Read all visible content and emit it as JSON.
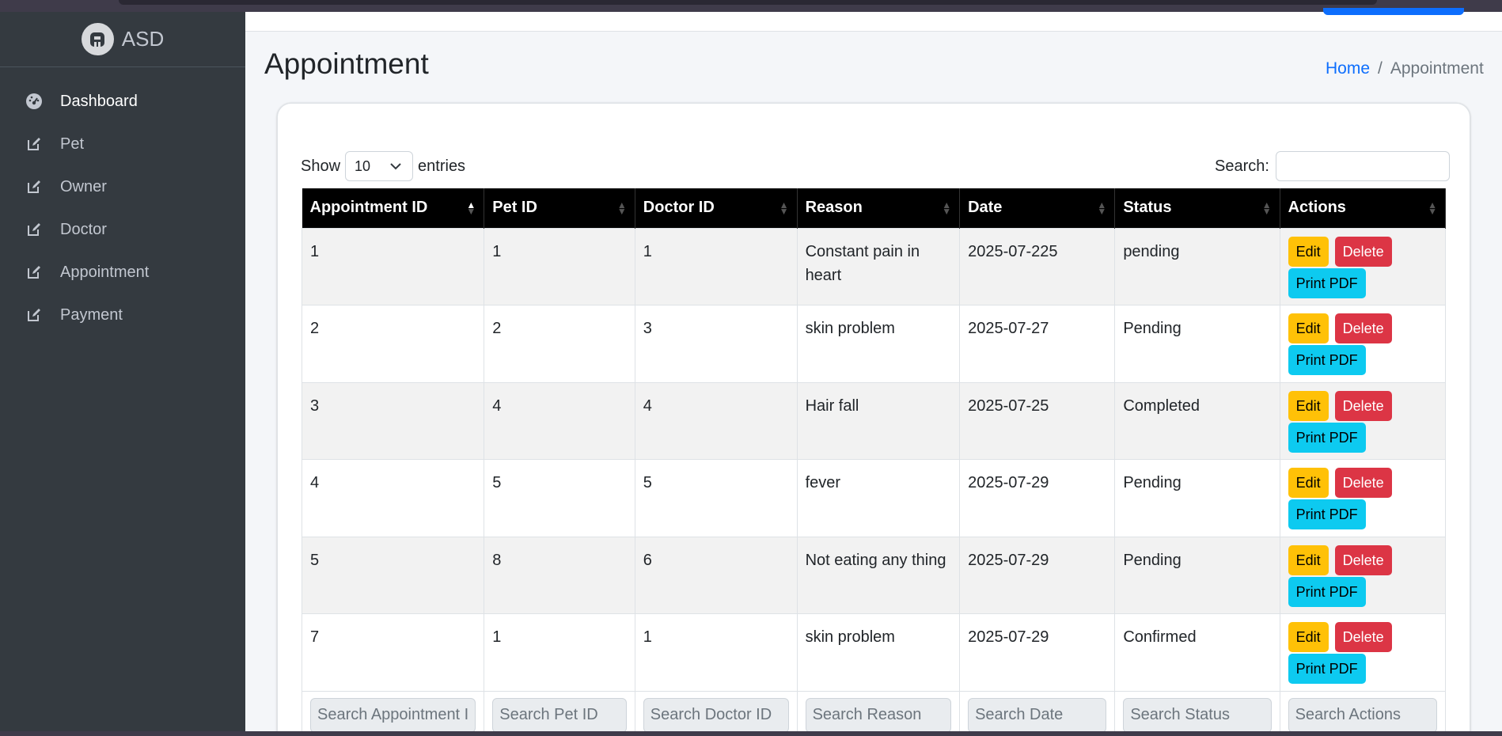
{
  "brand": {
    "name": "ASD"
  },
  "sidebar": {
    "items": [
      {
        "label": "Dashboard",
        "icon": "dashboard-icon"
      },
      {
        "label": "Pet",
        "icon": "edit-icon"
      },
      {
        "label": "Owner",
        "icon": "edit-icon"
      },
      {
        "label": "Doctor",
        "icon": "edit-icon"
      },
      {
        "label": "Appointment",
        "icon": "edit-icon"
      },
      {
        "label": "Payment",
        "icon": "edit-icon"
      }
    ]
  },
  "page": {
    "title": "Appointment",
    "breadcrumb": {
      "home": "Home",
      "sep": "/",
      "current": "Appointment"
    }
  },
  "controls": {
    "show_label": "Show",
    "entries_value": "10",
    "entries_label": "entries",
    "search_label": "Search:"
  },
  "table": {
    "headers": [
      "Appointment ID",
      "Pet ID",
      "Doctor ID",
      "Reason",
      "Date",
      "Status",
      "Actions"
    ],
    "rows": [
      {
        "id": "1",
        "pet": "1",
        "doctor": "1",
        "reason": "Constant pain in heart",
        "date": "2025-07-225",
        "status": "pending"
      },
      {
        "id": "2",
        "pet": "2",
        "doctor": "3",
        "reason": "skin problem",
        "date": "2025-07-27",
        "status": "Pending"
      },
      {
        "id": "3",
        "pet": "4",
        "doctor": "4",
        "reason": "Hair fall",
        "date": "2025-07-25",
        "status": "Completed"
      },
      {
        "id": "4",
        "pet": "5",
        "doctor": "5",
        "reason": "fever",
        "date": "2025-07-29",
        "status": "Pending"
      },
      {
        "id": "5",
        "pet": "8",
        "doctor": "6",
        "reason": "Not eating any thing",
        "date": "2025-07-29",
        "status": "Pending"
      },
      {
        "id": "7",
        "pet": "1",
        "doctor": "1",
        "reason": "skin problem",
        "date": "2025-07-29",
        "status": "Confirmed"
      }
    ],
    "actions": {
      "edit": "Edit",
      "delete": "Delete",
      "pdf": "Print PDF"
    },
    "footer_placeholders": [
      "Search Appointment I",
      "Search Pet ID",
      "Search Doctor ID",
      "Search Reason",
      "Search Date",
      "Search Status",
      "Search Actions"
    ]
  },
  "colors": {
    "sidebar_bg": "#343a40",
    "primary": "#0d6efd",
    "warning": "#ffc107",
    "danger": "#dc3545",
    "info": "#0dcaf0"
  }
}
